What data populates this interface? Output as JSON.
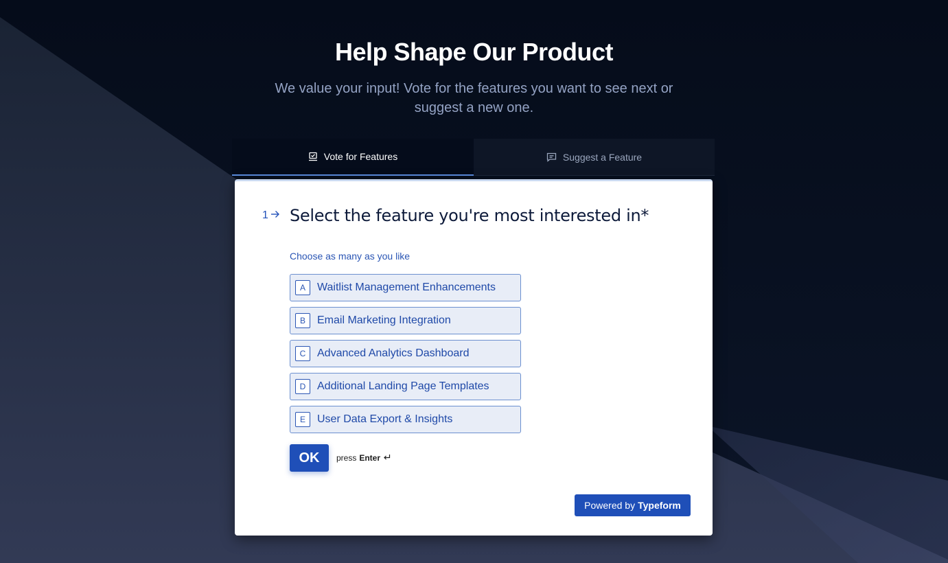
{
  "hero": {
    "title": "Help Shape Our Product",
    "subtitle": "We value your input! Vote for the features you want to see next or suggest a new one."
  },
  "tabs": [
    {
      "label": "Vote for Features",
      "icon": "ballot-box-icon",
      "active": true
    },
    {
      "label": "Suggest a Feature",
      "icon": "message-square-icon",
      "active": false
    }
  ],
  "question": {
    "number": "1",
    "title": "Select the feature you're most interested in*",
    "hint": "Choose as many as you like",
    "options": [
      {
        "key": "A",
        "label": "Waitlist Management Enhancements"
      },
      {
        "key": "B",
        "label": "Email Marketing Integration"
      },
      {
        "key": "C",
        "label": "Advanced Analytics Dashboard"
      },
      {
        "key": "D",
        "label": "Additional Landing Page Templates"
      },
      {
        "key": "E",
        "label": "User Data Export & Insights"
      }
    ],
    "ok_label": "OK",
    "press_text": "press",
    "press_key": "Enter"
  },
  "footer": {
    "powered_prefix": "Powered by",
    "powered_brand": "Typeform"
  },
  "colors": {
    "page_background": "#07101f",
    "accent": "#1f4fb8",
    "option_background": "#e8edf7",
    "option_border": "#6b8fcf"
  }
}
